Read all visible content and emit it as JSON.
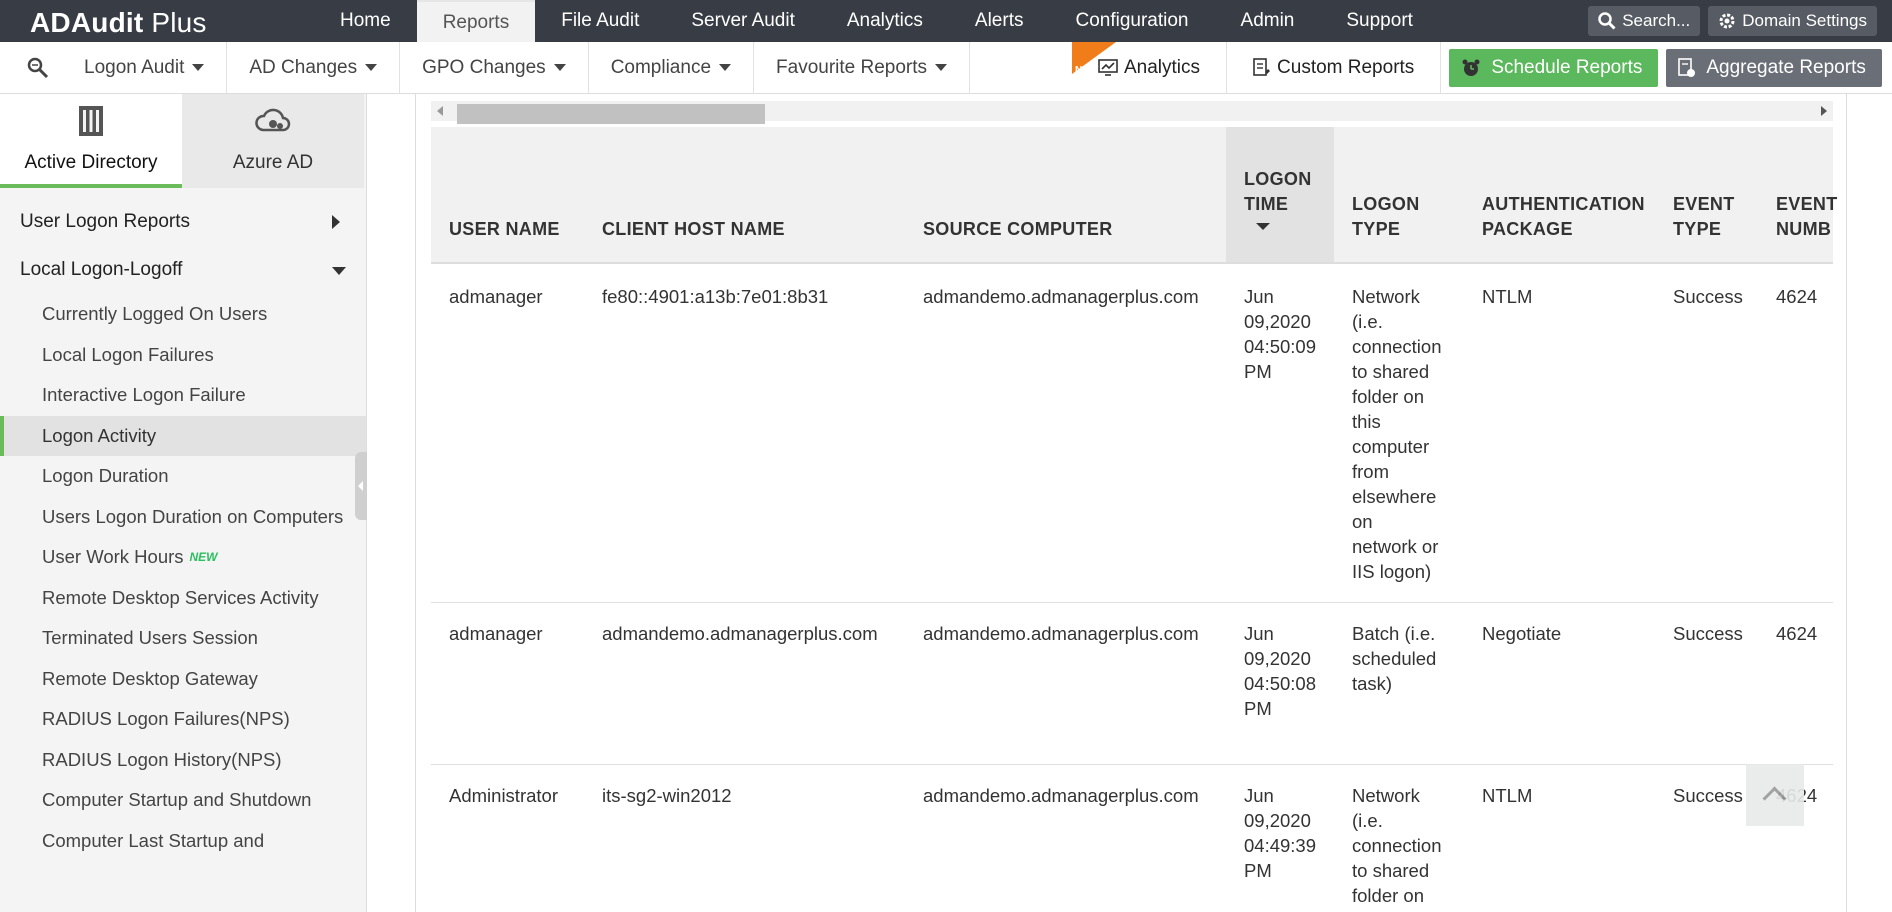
{
  "app": {
    "title_main": "ADAudit",
    "title_suffix": " Plus"
  },
  "topnav": {
    "tabs": [
      {
        "label": "Home"
      },
      {
        "label": "Reports",
        "active": true
      },
      {
        "label": "File Audit"
      },
      {
        "label": "Server Audit"
      },
      {
        "label": "Analytics"
      },
      {
        "label": "Alerts"
      },
      {
        "label": "Configuration"
      },
      {
        "label": "Admin"
      },
      {
        "label": "Support"
      }
    ],
    "search_label": "Search...",
    "domain_settings_label": "Domain Settings"
  },
  "submenu": {
    "items": [
      {
        "label": "Logon Audit"
      },
      {
        "label": "AD Changes"
      },
      {
        "label": "GPO Changes"
      },
      {
        "label": "Compliance"
      },
      {
        "label": "Favourite Reports"
      }
    ],
    "new_flag": "NEW",
    "analytics_label": "Analytics",
    "custom_reports_label": "Custom Reports",
    "schedule_reports_label": "Schedule Reports",
    "aggregate_reports_label": "Aggregate Reports"
  },
  "sidebar": {
    "tabs": [
      {
        "label": "Active Directory",
        "icon": "building-icon",
        "active": true
      },
      {
        "label": "Azure AD",
        "icon": "cloud-icon",
        "active": false
      }
    ],
    "sections": [
      {
        "label": "User Logon Reports",
        "expanded": false
      },
      {
        "label": "Local Logon-Logoff",
        "expanded": true
      }
    ],
    "items": [
      {
        "label": "Currently Logged On Users"
      },
      {
        "label": "Local Logon Failures"
      },
      {
        "label": "Interactive Logon Failure"
      },
      {
        "label": "Logon Activity",
        "active": true
      },
      {
        "label": "Logon Duration"
      },
      {
        "label": "Users Logon Duration on Computers"
      },
      {
        "label": "User Work Hours",
        "badge": "NEW"
      },
      {
        "label": "Remote Desktop Services Activity"
      },
      {
        "label": "Terminated Users Session"
      },
      {
        "label": "Remote Desktop Gateway"
      },
      {
        "label": "RADIUS Logon Failures(NPS)"
      },
      {
        "label": "RADIUS Logon History(NPS)"
      },
      {
        "label": "Computer Startup and Shutdown"
      },
      {
        "label": "Computer Last Startup and"
      }
    ]
  },
  "table": {
    "columns": [
      {
        "line1": "USER NAME",
        "line2": "",
        "line3": ""
      },
      {
        "line1": "CLIENT HOST NAME",
        "line2": "",
        "line3": ""
      },
      {
        "line1": "SOURCE COMPUTER",
        "line2": "",
        "line3": ""
      },
      {
        "line1": "LOGON",
        "line2": "TIME",
        "line3": "",
        "sorted": "desc"
      },
      {
        "line1": "LOGON",
        "line2": "TYPE",
        "line3": ""
      },
      {
        "line1": "AUTHENTICATION",
        "line2": "PACKAGE",
        "line3": ""
      },
      {
        "line1": "EVENT",
        "line2": "TYPE",
        "line3": ""
      },
      {
        "line1": "EVENT",
        "line2": "NUMB",
        "line3": ""
      }
    ],
    "rows": [
      {
        "user": "admanager",
        "client_host": "fe80::4901:a13b:7e01:8b31",
        "source_computer": "admandemo.admanagerplus.com",
        "logon_time": [
          "Jun",
          "09,2020",
          "04:50:09",
          "PM"
        ],
        "logon_type": [
          "Network",
          "(i.e.",
          "connection",
          "to shared",
          "folder on",
          "this",
          "computer",
          "from",
          "elsewhere",
          "on",
          "network or",
          "IIS logon)"
        ],
        "auth_package": "NTLM",
        "event_type": "Success",
        "event_number": "4624"
      },
      {
        "user": "admanager",
        "client_host": "admandemo.admanagerplus.com",
        "source_computer": "admandemo.admanagerplus.com",
        "logon_time": [
          "Jun",
          "09,2020",
          "04:50:08",
          "PM"
        ],
        "logon_type": [
          "Batch (i.e.",
          "scheduled",
          "task)"
        ],
        "auth_package": "Negotiate",
        "event_type": "Success",
        "event_number": "4624"
      },
      {
        "user": "Administrator",
        "client_host": "its-sg2-win2012",
        "source_computer": "admandemo.admanagerplus.com",
        "logon_time": [
          "Jun",
          "09,2020",
          "04:49:39",
          "PM"
        ],
        "logon_type": [
          "Network",
          "(i.e.",
          "connection",
          "to shared",
          "folder on"
        ],
        "auth_package": "NTLM",
        "event_type": "Success",
        "event_number": "4624"
      }
    ]
  }
}
